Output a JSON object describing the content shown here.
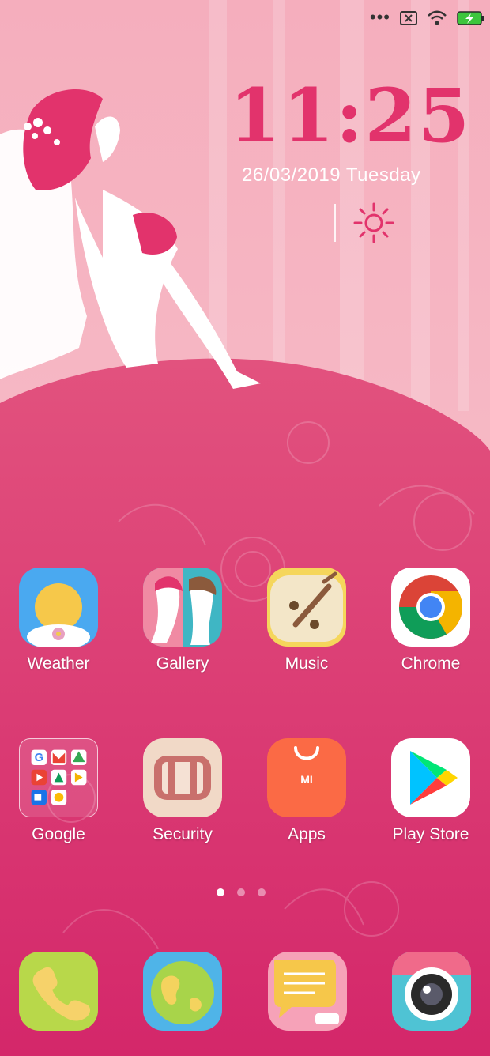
{
  "status_bar": {
    "dots": "•••",
    "battery_state": "charging"
  },
  "clock": {
    "time": "11:25",
    "date": "26/03/2019  Tuesday",
    "weather_icon": "sun-icon"
  },
  "apps_row1": [
    {
      "label": "Weather",
      "icon": "weather-icon"
    },
    {
      "label": "Gallery",
      "icon": "gallery-icon"
    },
    {
      "label": "Music",
      "icon": "music-icon"
    },
    {
      "label": "Chrome",
      "icon": "chrome-icon"
    }
  ],
  "apps_row2": [
    {
      "label": "Google",
      "icon": "google-folder-icon"
    },
    {
      "label": "Security",
      "icon": "security-icon"
    },
    {
      "label": "Apps",
      "icon": "mi-apps-icon",
      "badge": "MI"
    },
    {
      "label": "Play Store",
      "icon": "play-store-icon"
    }
  ],
  "pager": {
    "pages": 3,
    "active": 1
  },
  "dock": [
    {
      "icon": "phone-icon"
    },
    {
      "icon": "browser-icon"
    },
    {
      "icon": "messages-icon"
    },
    {
      "icon": "camera-icon"
    }
  ],
  "colors": {
    "clock": "#e2336c",
    "wallpaper_top": "#f4b6c2",
    "wallpaper_dress": "#e0457a",
    "wallpaper_bottom": "#d42a6a"
  }
}
